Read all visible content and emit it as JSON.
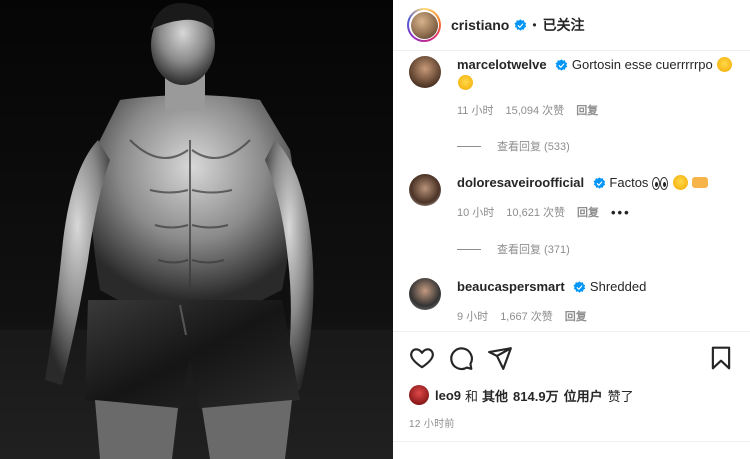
{
  "post": {
    "username": "cristiano",
    "separator": "•",
    "follow_label": "已关注"
  },
  "comments": [
    {
      "username": "marcelotwelve",
      "text": "Gortosin esse cuerrrrrpo",
      "time": "11 小时",
      "likes": "15,094 次赞",
      "reply_label": "回复",
      "view_replies": "查看回复 (533)"
    },
    {
      "username": "doloresaveiroofficial",
      "text": "Factos",
      "time": "10 小时",
      "likes": "10,621 次赞",
      "reply_label": "回复",
      "more": "•••",
      "view_replies": "查看回复 (371)"
    },
    {
      "username": "beaucaspersmart",
      "text": "Shredded",
      "time": "9 小时",
      "likes": "1,667 次赞",
      "reply_label": "回复"
    }
  ],
  "likes_line": {
    "user": "leo9",
    "conj": "和",
    "others_label": "其他",
    "count": "814.9万",
    "users_label": "位用户",
    "suffix": "赞了"
  },
  "posted_time": "12 小时前",
  "icons": [
    "heart-icon",
    "comment-icon",
    "share-icon",
    "save-icon",
    "verified-badge-icon"
  ],
  "colors": {
    "verified": "#0095f6",
    "secondary_text": "#8e8e8e",
    "primary_text": "#262626"
  }
}
